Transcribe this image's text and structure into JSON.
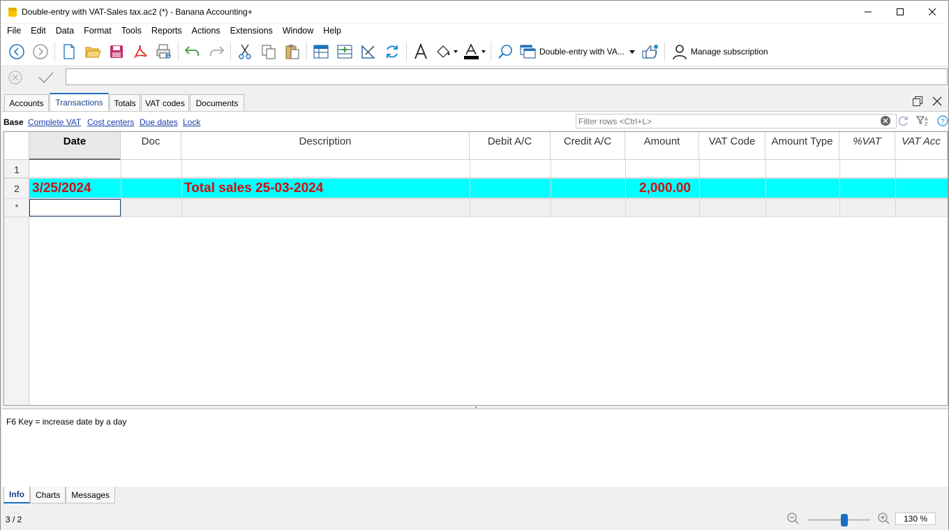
{
  "window": {
    "title": "Double-entry with VAT-Sales tax.ac2 (*) - Banana Accounting+"
  },
  "menu": [
    "File",
    "Edit",
    "Data",
    "Format",
    "Tools",
    "Reports",
    "Actions",
    "Extensions",
    "Window",
    "Help"
  ],
  "toolbar": {
    "file_selector_label": "Double-entry with VA...",
    "manage_subscription_label": "Manage subscription"
  },
  "tabs": [
    "Accounts",
    "Transactions",
    "Totals",
    "VAT codes",
    "Documents"
  ],
  "active_tab": "Transactions",
  "views": {
    "base": "Base",
    "links": [
      "Complete VAT",
      "Cost centers",
      "Due dates",
      "Lock"
    ]
  },
  "filter": {
    "placeholder": "Filter rows <Ctrl+L>"
  },
  "table": {
    "columns": [
      "Date",
      "Doc",
      "Description",
      "Debit A/C",
      "Credit A/C",
      "Amount",
      "VAT Code",
      "Amount Type",
      "%VAT",
      "VAT Acc"
    ],
    "rows": [
      {
        "num": "1",
        "date": "",
        "doc": "",
        "description": "",
        "amount": ""
      },
      {
        "num": "2",
        "date": "3/25/2024",
        "doc": "",
        "description": "Total sales 25-03-2024",
        "amount": "2,000.00"
      },
      {
        "num": "*",
        "date": "",
        "doc": "",
        "description": "",
        "amount": ""
      }
    ]
  },
  "info": {
    "text": "F6 Key = increase date by a day"
  },
  "bottom_tabs": [
    "Info",
    "Charts",
    "Messages"
  ],
  "status": {
    "position": "3 / 2",
    "zoom": "130 %",
    "zoom_level_percent": 130
  },
  "colors": {
    "highlight_row": "#00ffff",
    "highlight_text": "#d01010",
    "accent": "#1a6fc4"
  }
}
